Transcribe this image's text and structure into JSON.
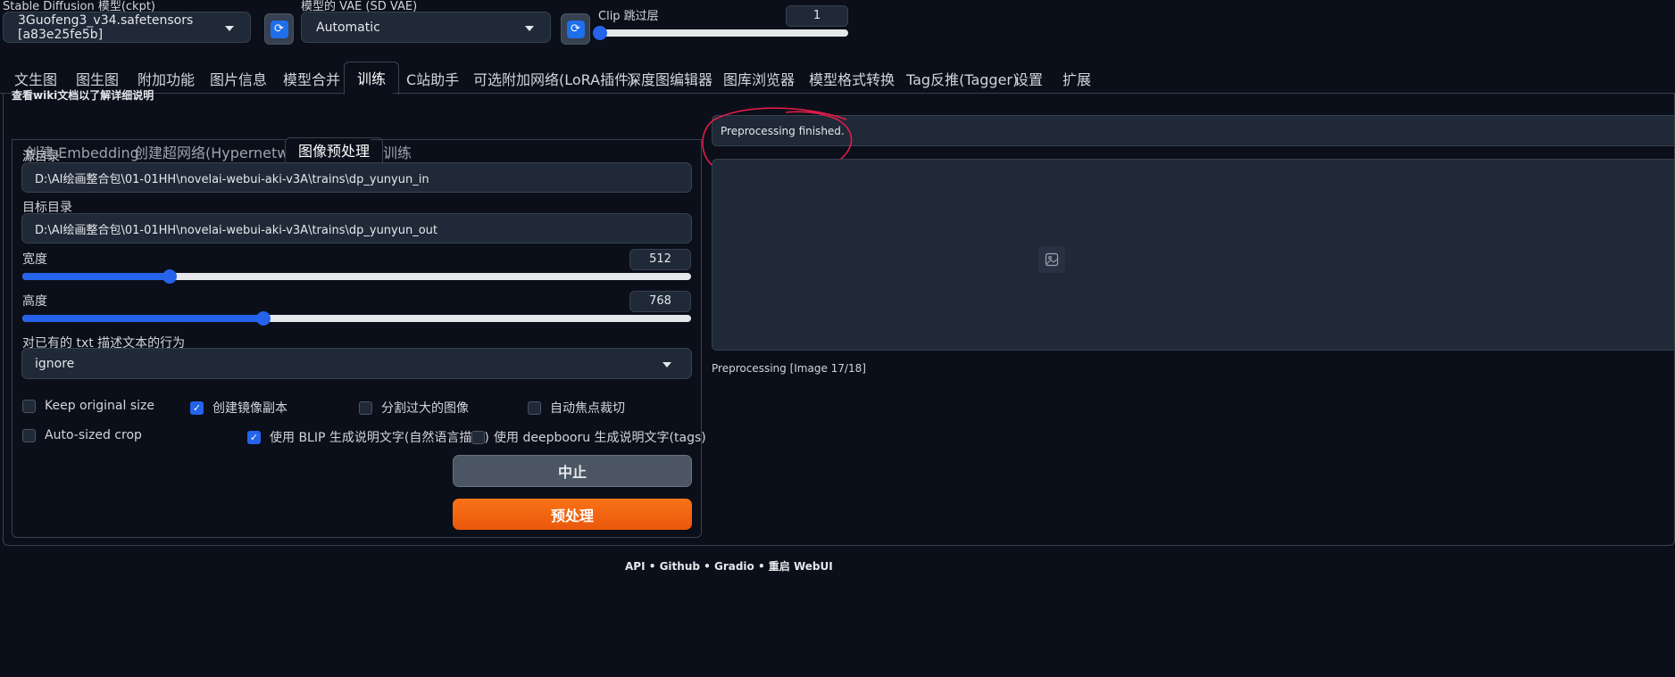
{
  "top": {
    "ckpt_label": "Stable Diffusion 模型(ckpt)",
    "ckpt_value": "3Guofeng3_v34.safetensors [a83e25fe5b]",
    "vae_label": "模型的 VAE (SD VAE)",
    "vae_value": "Automatic",
    "clip_label": "Clip 跳过层",
    "clip_value": "1",
    "clip_fraction": 0.0
  },
  "main_tabs": [
    "文生图",
    "图生图",
    "附加功能",
    "图片信息",
    "模型合并",
    "训练",
    "C站助手",
    "可选附加网络(LoRA插件)",
    "深度图编辑器",
    "图库浏览器",
    "模型格式转换",
    "Tag反推(Tagger)",
    "设置",
    "扩展"
  ],
  "wiki_note": "查看wiki文档以了解详细说明",
  "sub_tabs": [
    "创建 Embedding",
    "创建超网络(Hypernetwork)",
    "图像预处理",
    "训练"
  ],
  "form": {
    "src_label": "源目录",
    "src_value": "D:\\AI绘画整合包\\01-01HH\\novelai-webui-aki-v3A\\trains\\dp_yunyun_in",
    "dst_label": "目标目录",
    "dst_value": "D:\\AI绘画整合包\\01-01HH\\novelai-webui-aki-v3A\\trains\\dp_yunyun_out",
    "width_label": "宽度",
    "width_value": "512",
    "width_fraction": 0.22,
    "height_label": "高度",
    "height_value": "768",
    "height_fraction": 0.36,
    "txt_label": "对已有的 txt 描述文本的行为",
    "txt_value": "ignore"
  },
  "checkboxes": {
    "keep_original": {
      "label": "Keep original size",
      "checked": false
    },
    "mirror": {
      "label": "创建镜像副本",
      "checked": true
    },
    "split": {
      "label": "分割过大的图像",
      "checked": false
    },
    "autofocus": {
      "label": "自动焦点裁切",
      "checked": false
    },
    "autosize": {
      "label": "Auto-sized crop",
      "checked": false
    },
    "blip": {
      "label": "使用 BLIP 生成说明文字(自然语言描述)",
      "checked": true
    },
    "deepbooru": {
      "label": "使用 deepbooru 生成说明文字(tags)",
      "checked": false
    }
  },
  "buttons": {
    "interrupt": "中止",
    "preprocess": "预处理"
  },
  "output": {
    "status": "Preprocessing finished.",
    "progress": "Preprocessing [Image 17/18]"
  },
  "footer": "API  •  Github  •  Gradio  •  重启 WebUI",
  "colors": {
    "accent": "#2563eb",
    "primary_button": "#f97316",
    "annotation": "#e11d48"
  }
}
